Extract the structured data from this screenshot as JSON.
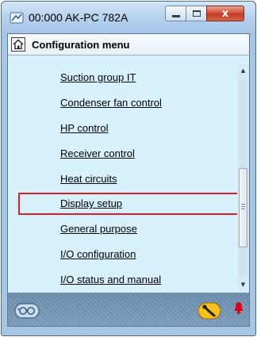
{
  "window": {
    "title": "00:000 AK-PC 782A",
    "app_icon": "controller-icon",
    "buttons": {
      "minimize": "minimize-icon",
      "maximize": "maximize-icon",
      "close_glyph": "x"
    }
  },
  "header": {
    "home_icon": "home-icon",
    "title": "Configuration menu"
  },
  "menu": {
    "items": [
      {
        "label": "Suction group IT"
      },
      {
        "label": "Condenser fan control"
      },
      {
        "label": "HP control"
      },
      {
        "label": "Receiver control"
      },
      {
        "label": "Heat circuits"
      },
      {
        "label": "Display setup",
        "highlighted": true
      },
      {
        "label": "General purpose"
      },
      {
        "label": "I/O configuration"
      },
      {
        "label": "I/O status and manual"
      }
    ],
    "highlight_color": "#e31b23"
  },
  "scrollbar": {
    "up_arrow": "▲",
    "down_arrow": "▼",
    "position_fraction": 0.62
  },
  "statusbar": {
    "left_icon": "glasses-icon",
    "tool_icon": "wrench-icon",
    "alarm_icon": "alarm-bell-icon",
    "alarm_color": "#e0001b"
  }
}
